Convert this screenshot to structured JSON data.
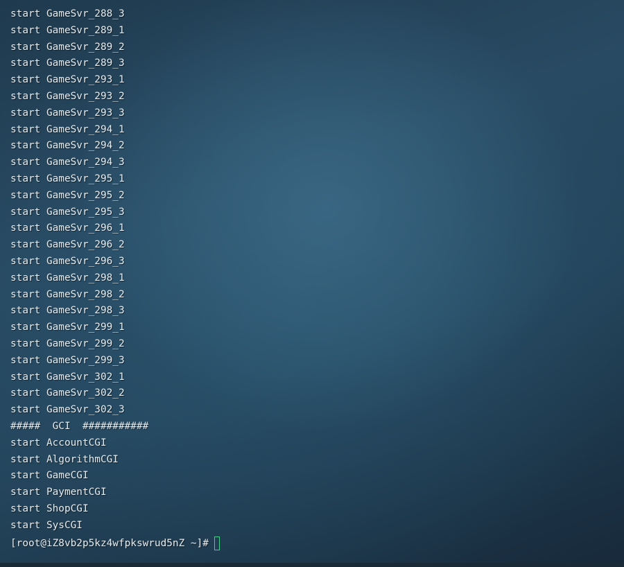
{
  "terminal": {
    "lines": [
      "start GameSvr_288_3",
      "start GameSvr_289_1",
      "start GameSvr_289_2",
      "start GameSvr_289_3",
      "start GameSvr_293_1",
      "start GameSvr_293_2",
      "start GameSvr_293_3",
      "start GameSvr_294_1",
      "start GameSvr_294_2",
      "start GameSvr_294_3",
      "start GameSvr_295_1",
      "start GameSvr_295_2",
      "start GameSvr_295_3",
      "start GameSvr_296_1",
      "start GameSvr_296_2",
      "start GameSvr_296_3",
      "start GameSvr_298_1",
      "start GameSvr_298_2",
      "start GameSvr_298_3",
      "start GameSvr_299_1",
      "start GameSvr_299_2",
      "start GameSvr_299_3",
      "start GameSvr_302_1",
      "start GameSvr_302_2",
      "start GameSvr_302_3",
      "#####  GCI  ###########",
      "start AccountCGI",
      "start AlgorithmCGI",
      "start GameCGI",
      "start PaymentCGI",
      "start ShopCGI",
      "start SysCGI"
    ],
    "prompt": "[root@iZ8vb2p5kz4wfpkswrud5nZ ~]#",
    "cursor_color": "#3fd08a",
    "text_color": "#e6ecef"
  }
}
